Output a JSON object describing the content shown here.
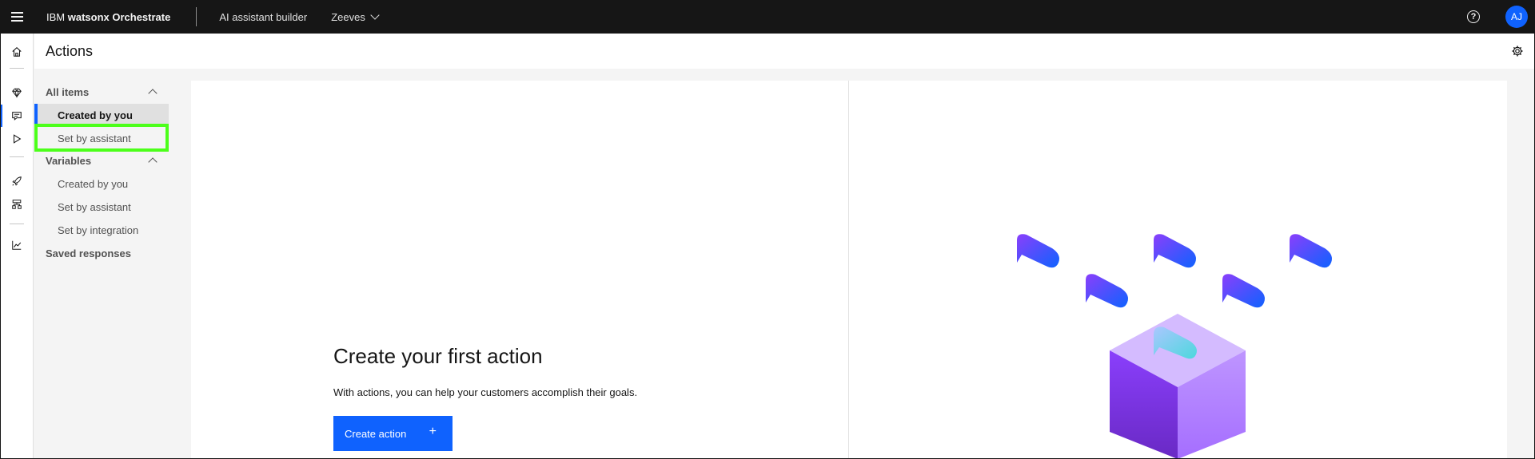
{
  "header": {
    "brand_prefix": "IBM ",
    "brand_product": "watsonx Orchestrate",
    "builder_label": "AI assistant builder",
    "assistant_name": "Zeeves",
    "help_glyph": "?",
    "avatar_initials": "AJ"
  },
  "page": {
    "title": "Actions"
  },
  "subnav": {
    "all_items": {
      "label": "All items",
      "items": [
        {
          "label": "Created by you"
        },
        {
          "label": "Set by assistant"
        }
      ]
    },
    "variables": {
      "label": "Variables",
      "items": [
        {
          "label": "Created by you"
        },
        {
          "label": "Set by assistant"
        },
        {
          "label": "Set by integration"
        }
      ]
    },
    "saved_responses": {
      "label": "Saved responses"
    }
  },
  "empty_state": {
    "title": "Create your first action",
    "description": "With actions, you can help your customers accomplish their goals.",
    "button_label": "Create action",
    "button_icon": "+"
  },
  "colors": {
    "accent": "#0f62fe",
    "topbar": "#161616",
    "highlight": "#4cff1a"
  }
}
